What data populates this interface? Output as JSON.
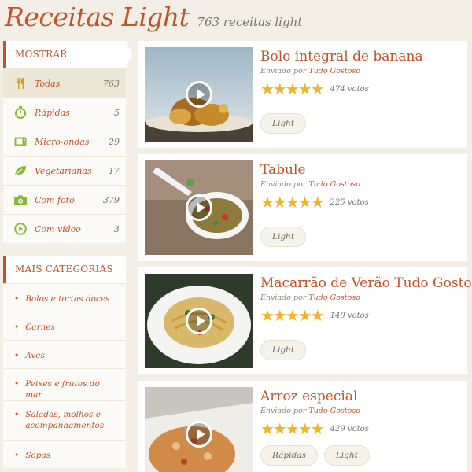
{
  "header": {
    "title": "Receitas Light",
    "count": "763 receitas light"
  },
  "sidebar": {
    "show_title": "MOSTRAR",
    "filters": [
      {
        "label": "Todas",
        "count": "763",
        "icon": "utensils-icon",
        "active": true
      },
      {
        "label": "Rápidas",
        "count": "5",
        "icon": "timer-icon"
      },
      {
        "label": "Micro-ondas",
        "count": "29",
        "icon": "microwave-icon"
      },
      {
        "label": "Vegetarianas",
        "count": "17",
        "icon": "leaf-icon"
      },
      {
        "label": "Com foto",
        "count": "379",
        "icon": "camera-icon"
      },
      {
        "label": "Com vídeo",
        "count": "3",
        "icon": "play-circle-icon"
      }
    ],
    "categories_title": "MAIS CATEGORIAS",
    "categories": [
      "Bolos e tortas doces",
      "Carnes",
      "Aves",
      "Peixes e frutos do mar",
      "Saladas, molhos e acompanhamentos",
      "Sopas"
    ]
  },
  "recipes": [
    {
      "title": "Bolo integral de banana",
      "sent_by": "Enviado por",
      "author": "Tudo Gostoso",
      "stars": "★★★★★",
      "votes": "474 votos",
      "tags": [
        "Light"
      ]
    },
    {
      "title": "Tabule",
      "sent_by": "Enviado por",
      "author": "Tudo Gostoso",
      "stars": "★★★★★",
      "votes": "225 votos",
      "tags": [
        "Light"
      ]
    },
    {
      "title": "Macarrão de Verão Tudo Gostoso",
      "sent_by": "Enviado por",
      "author": "Tudo Gostoso",
      "stars": "★★★★★",
      "votes": "140 votos",
      "tags": [
        "Light"
      ]
    },
    {
      "title": "Arroz especial",
      "sent_by": "Enviado por",
      "author": "Tudo Gostoso",
      "stars": "★★★★★",
      "votes": "429 votos",
      "tags": [
        "Rápidas",
        "Light"
      ]
    }
  ],
  "colors": {
    "accent": "#c1542b",
    "star": "#f0b429",
    "background": "#f3efe6"
  }
}
